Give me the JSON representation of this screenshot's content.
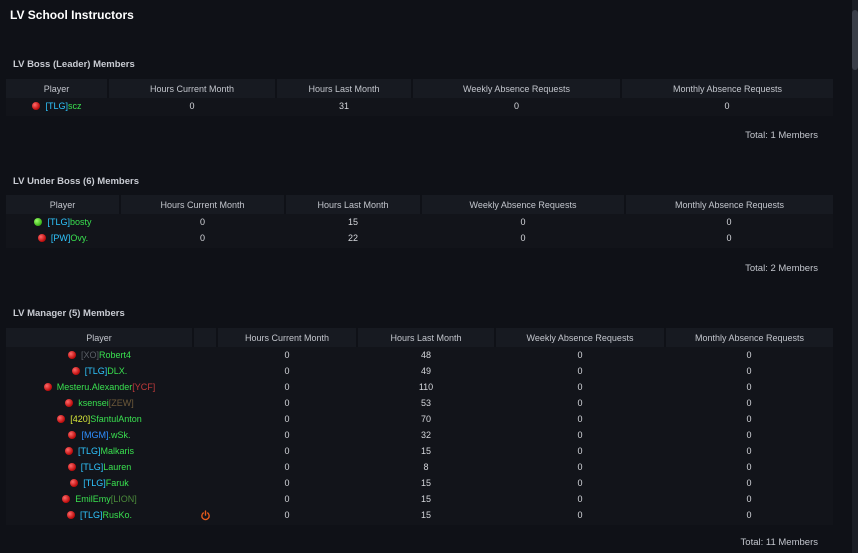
{
  "page_title": "LV School Instructors",
  "sections": [
    {
      "title": "LV Boss (Leader) Members",
      "columns": [
        "Player",
        "Hours Current Month",
        "Hours Last Month",
        "Weekly Absence Requests",
        "Monthly Absence Requests"
      ],
      "rows": [
        {
          "status": "offline",
          "tag": "[TLG]",
          "name": "scz",
          "hours_current": "0",
          "hours_last": "31",
          "weekly": "0",
          "monthly": "0"
        }
      ],
      "total": "Total: 1 Members"
    },
    {
      "title": "LV Under Boss (6) Members",
      "columns": [
        "Player",
        "Hours Current Month",
        "Hours Last Month",
        "Weekly Absence Requests",
        "Monthly Absence Requests"
      ],
      "rows": [
        {
          "status": "online",
          "tag": "[TLG]",
          "name": "bosty",
          "hours_current": "0",
          "hours_last": "15",
          "weekly": "0",
          "monthly": "0"
        },
        {
          "status": "offline",
          "tag": "[PW]",
          "name": "Ovy.",
          "hours_current": "0",
          "hours_last": "22",
          "weekly": "0",
          "monthly": "0"
        }
      ],
      "total": "Total: 2 Members"
    },
    {
      "title": "LV Manager (5) Members",
      "columns": [
        "Player",
        "",
        "Hours Current Month",
        "Hours Last Month",
        "Weekly Absence Requests",
        "Monthly Absence Requests"
      ],
      "rows": [
        {
          "status": "offline",
          "prefix": "[XO]",
          "name": "Robert4",
          "suffix": "",
          "hours_current": "0",
          "hours_last": "48",
          "weekly": "0",
          "monthly": "0"
        },
        {
          "status": "offline",
          "prefix": "[TLG]",
          "name": "DLX.",
          "suffix": "",
          "hours_current": "0",
          "hours_last": "49",
          "weekly": "0",
          "monthly": "0"
        },
        {
          "status": "offline",
          "prefix": "",
          "name": "Mesteru.Alexander",
          "suffix": "[YCF]",
          "hours_current": "0",
          "hours_last": "110",
          "weekly": "0",
          "monthly": "0"
        },
        {
          "status": "offline",
          "prefix": "",
          "name": "ksensei",
          "suffix": "[ZEW]",
          "hours_current": "0",
          "hours_last": "53",
          "weekly": "0",
          "monthly": "0"
        },
        {
          "status": "offline",
          "prefix": "[420]",
          "name": "SfantulAnton",
          "suffix": "",
          "hours_current": "0",
          "hours_last": "70",
          "weekly": "0",
          "monthly": "0"
        },
        {
          "status": "offline",
          "prefix": "[MGM]",
          "name": ".wSk.",
          "suffix": "",
          "hours_current": "0",
          "hours_last": "32",
          "weekly": "0",
          "monthly": "0"
        },
        {
          "status": "offline",
          "prefix": "[TLG]",
          "name": "Malkaris",
          "suffix": "",
          "hours_current": "0",
          "hours_last": "15",
          "weekly": "0",
          "monthly": "0"
        },
        {
          "status": "offline",
          "prefix": "[TLG]",
          "name": "Lauren",
          "suffix": "",
          "hours_current": "0",
          "hours_last": "8",
          "weekly": "0",
          "monthly": "0"
        },
        {
          "status": "offline",
          "prefix": "[TLG]",
          "name": "Faruk",
          "suffix": "",
          "hours_current": "0",
          "hours_last": "15",
          "weekly": "0",
          "monthly": "0"
        },
        {
          "status": "offline",
          "prefix": "",
          "name": "EmilEmy",
          "suffix": "[LION]",
          "hours_current": "0",
          "hours_last": "15",
          "weekly": "0",
          "monthly": "0"
        },
        {
          "status": "offline",
          "prefix": "[TLG]",
          "name": "RusKo.",
          "suffix": "",
          "hours_current": "0",
          "hours_last": "15",
          "weekly": "0",
          "monthly": "0",
          "action_icon": "power-icon"
        }
      ],
      "total": "Total: 11 Members"
    }
  ],
  "colors": {
    "background": "#0f1117",
    "header_bg": "#171a21",
    "tag_cyan": "#2fc6ff",
    "name_green": "#39e04f",
    "status_offline": "#d91a1a",
    "status_online": "#3fb51b",
    "power_icon": "#e85a1a"
  }
}
